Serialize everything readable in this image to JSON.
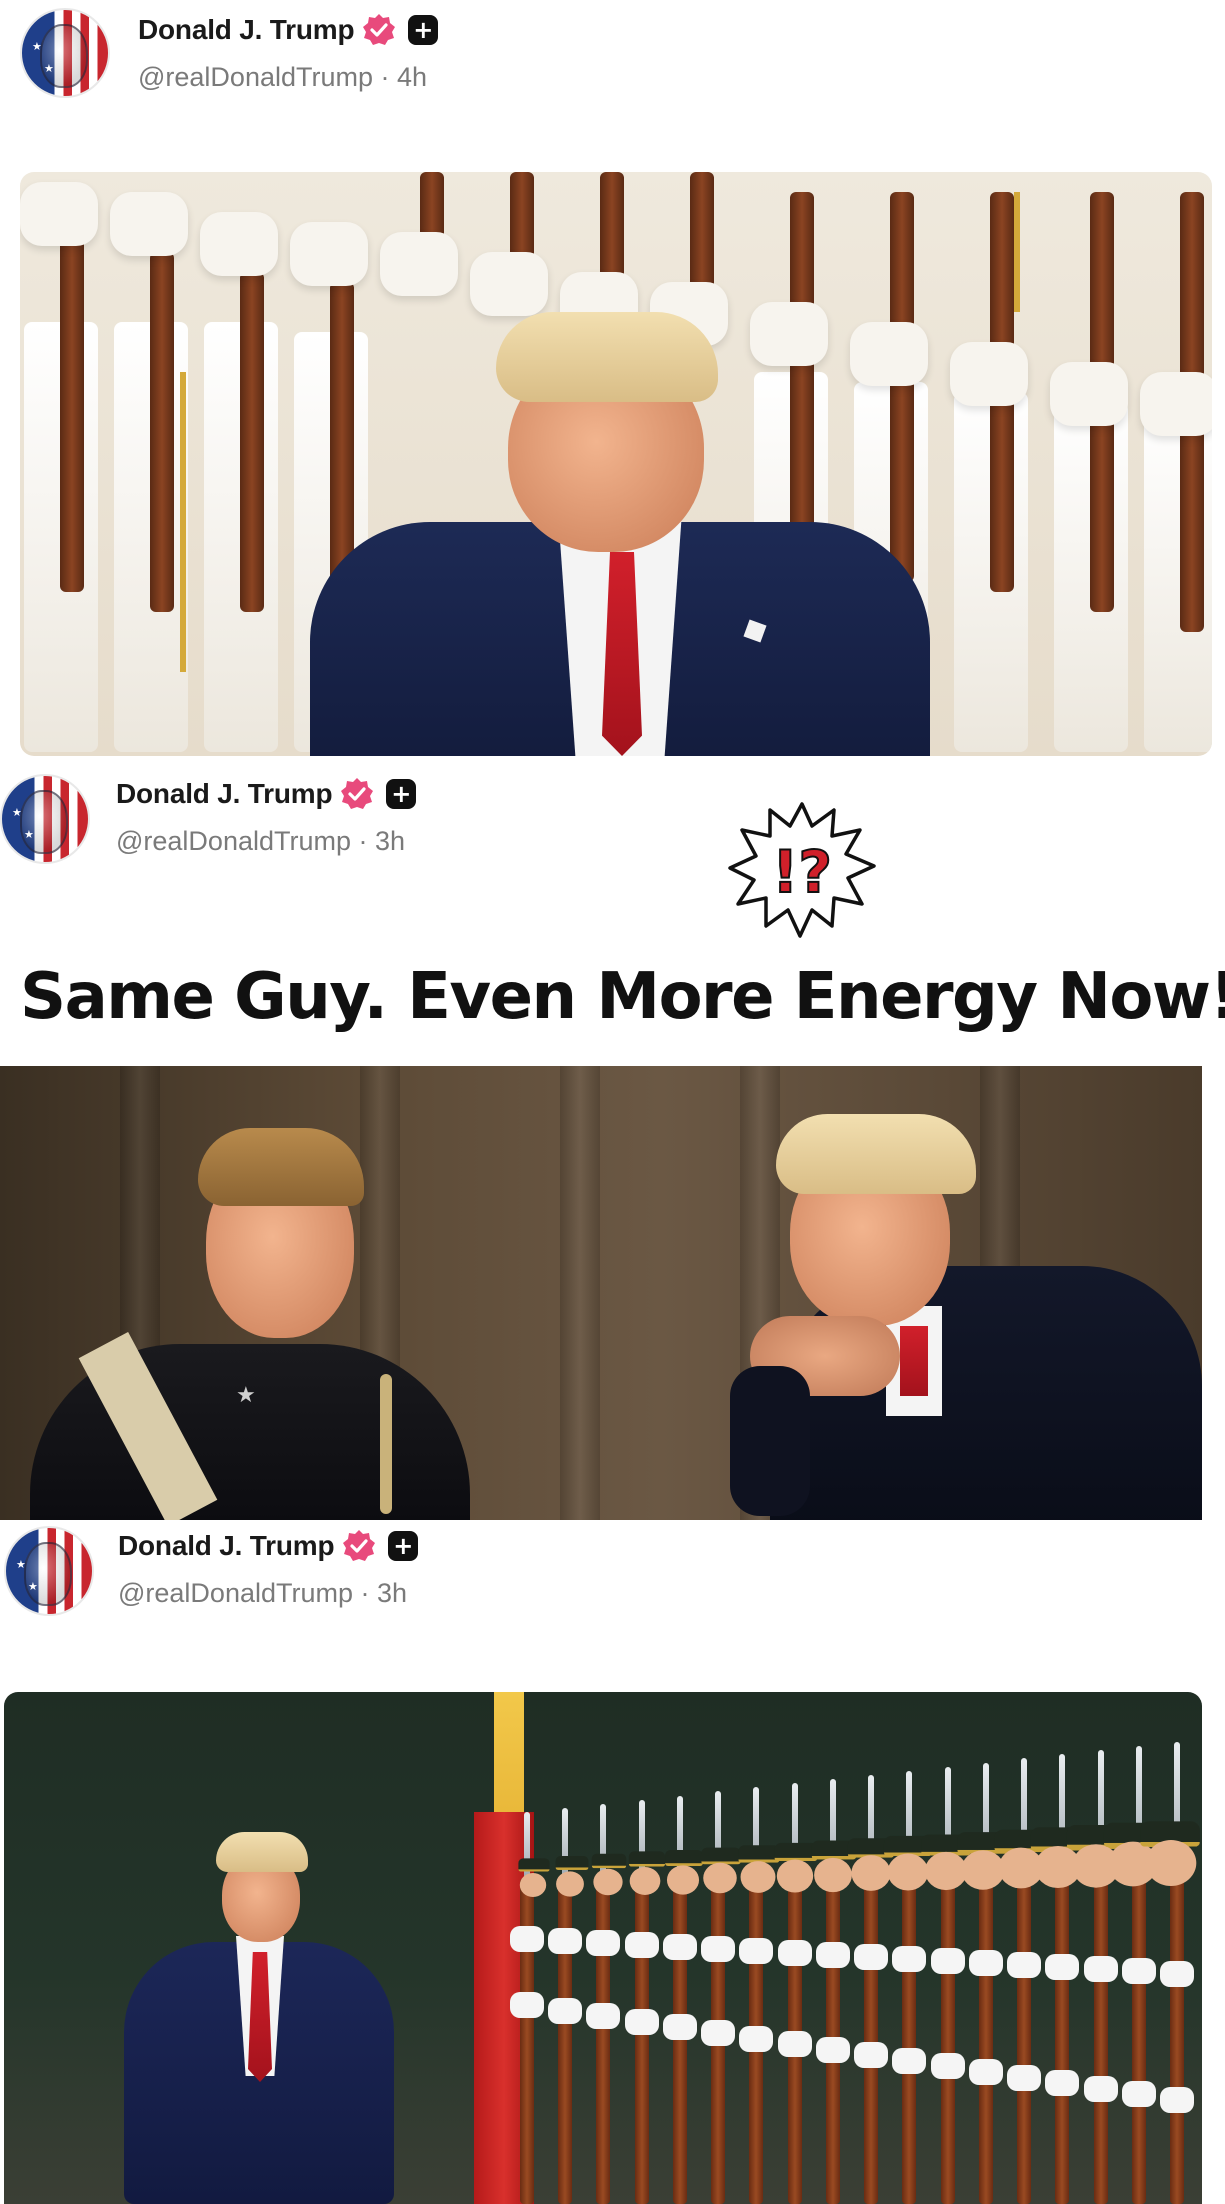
{
  "posts": [
    {
      "author": {
        "name": "Donald J. Trump",
        "handle_time": "@realDonaldTrump · 4h"
      },
      "image_icon": "photo-guard-ceremony"
    },
    {
      "author": {
        "name": "Donald J. Trump",
        "handle_time": "@realDonaldTrump · 3h"
      },
      "burst_icon": "exclamation-question-burst-icon",
      "burst_text": "!?",
      "headline": "Same Guy. Even More Energy Now!",
      "image_icon": "photo-cadet-and-elder"
    },
    {
      "author": {
        "name": "Donald J. Trump",
        "handle_time": "@realDonaldTrump · 3h"
      },
      "image_icon": "photo-military-parade"
    }
  ],
  "colors": {
    "verified_badge": "#e84a7c",
    "name_text": "#1a1a1a",
    "handle_text": "#7a7a7a",
    "headline_text": "#111111",
    "burst_text": "#d0202a"
  }
}
